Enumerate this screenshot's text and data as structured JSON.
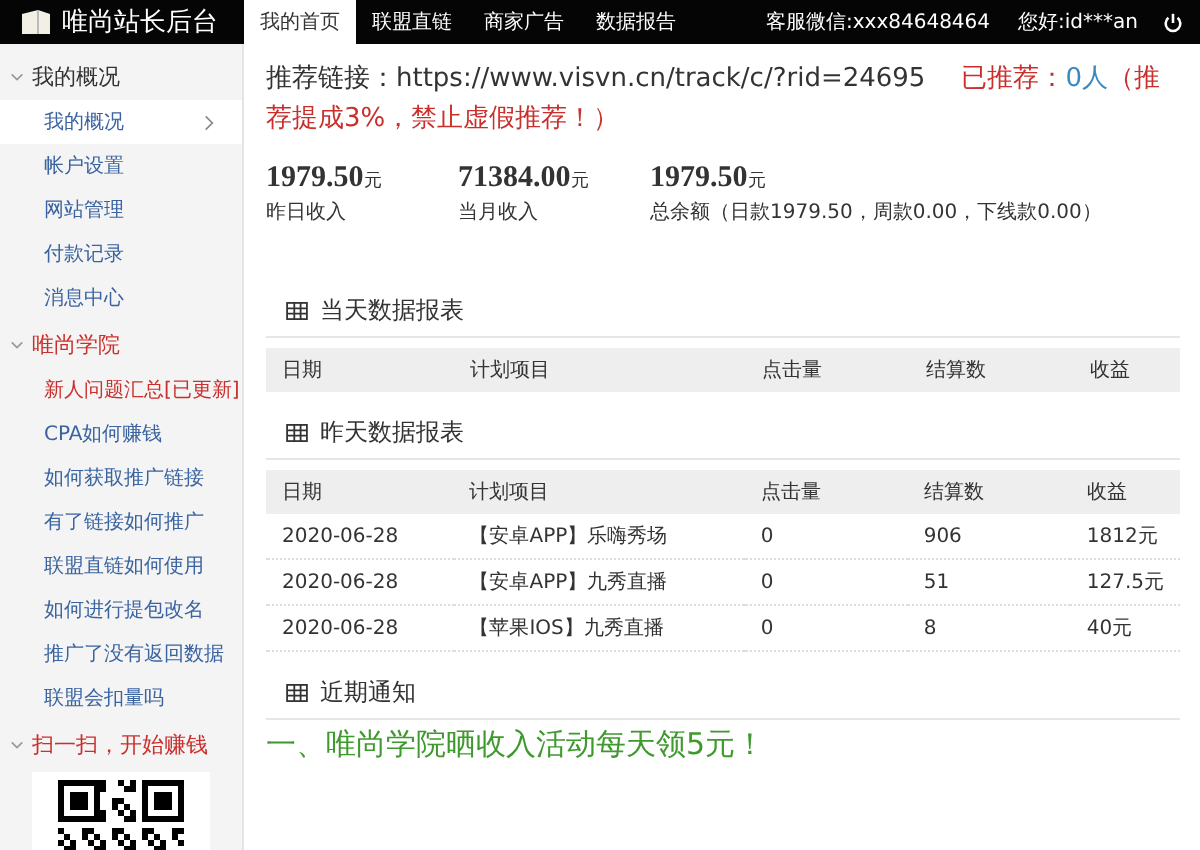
{
  "topbar": {
    "title": "唯尚站长后台",
    "tabs": [
      {
        "label": "我的首页",
        "selected": true
      },
      {
        "label": "联盟直链",
        "selected": false
      },
      {
        "label": "商家广告",
        "selected": false
      },
      {
        "label": "数据报告",
        "selected": false
      }
    ],
    "contact": "客服微信:xxx84648464",
    "greeting": "您好:id***an"
  },
  "sidebar": [
    {
      "title": "我的概况",
      "kind": "links",
      "expanded": true,
      "items": [
        {
          "label": "我的概况",
          "selected": true,
          "kind": "link"
        },
        {
          "label": "帐户设置",
          "selected": false,
          "kind": "link"
        },
        {
          "label": "网站管理",
          "selected": false,
          "kind": "link"
        },
        {
          "label": "付款记录",
          "selected": false,
          "kind": "link"
        },
        {
          "label": "消息中心",
          "selected": false,
          "kind": "link"
        }
      ]
    },
    {
      "title": "唯尚学院",
      "kind": "links",
      "expanded": true,
      "items": [
        {
          "label": "新人问题汇总[已更新]",
          "selected": false,
          "kind": "notice"
        },
        {
          "label": "CPA如何赚钱",
          "selected": false,
          "kind": "link"
        },
        {
          "label": "如何获取推广链接",
          "selected": false,
          "kind": "link"
        },
        {
          "label": "有了链接如何推广",
          "selected": false,
          "kind": "link"
        },
        {
          "label": "联盟直链如何使用",
          "selected": false,
          "kind": "link"
        },
        {
          "label": "如何进行提包改名",
          "selected": false,
          "kind": "link"
        },
        {
          "label": "推广了没有返回数据",
          "selected": false,
          "kind": "link"
        },
        {
          "label": "联盟会扣量吗",
          "selected": false,
          "kind": "link"
        }
      ]
    },
    {
      "title": "扫一扫，开始赚钱",
      "kind": "qr",
      "expanded": true
    }
  ],
  "referral": {
    "label": "推荐链接：",
    "url": "https://www.visvn.cn/track/c/?rid=24695",
    "count_label": "已推荐：",
    "count": "0人",
    "note": "（推荐提成3%，禁止虚假推荐！）"
  },
  "stats": [
    {
      "value": "1979.50",
      "unit": "元",
      "label": "昨日收入"
    },
    {
      "value": "71384.00",
      "unit": "元",
      "label": "当月收入"
    },
    {
      "value": "1979.50",
      "unit": "元",
      "label": "总余额（日款1979.50，周款0.00，下线款0.00）"
    }
  ],
  "tables": [
    {
      "title": "当天数据报表",
      "columns": [
        "日期",
        "计划项目",
        "点击量",
        "结算数",
        "收益"
      ]
    },
    {
      "title": "昨天数据报表",
      "columns": [
        "日期",
        "计划项目",
        "点击量",
        "结算数",
        "收益"
      ],
      "rows": [
        [
          "2020-06-28",
          "【安卓APP】乐嗨秀场",
          "0",
          "906",
          "1812元"
        ],
        [
          "2020-06-28",
          "【安卓APP】九秀直播",
          "0",
          "51",
          "127.5元"
        ],
        [
          "2020-06-28",
          "【苹果IOS】九秀直播",
          "0",
          "8",
          "40元"
        ]
      ]
    }
  ],
  "notices": {
    "title": "近期通知",
    "headline": "一、唯尚学院晒收入活动每天领5元！"
  }
}
